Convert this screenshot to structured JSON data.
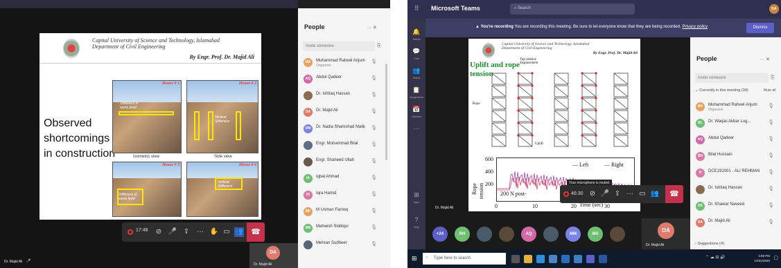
{
  "left": {
    "slide": {
      "university": "Capital University of Science and Technology, Islamabad",
      "department": "Department of Civil Engineering",
      "author": "By Engr. Prof. Dr. Majid Ali",
      "title_lines": [
        "Observed",
        "shortcomings",
        "in construction"
      ],
      "photos": [
        {
          "tag": "House # 1",
          "caption": "Stiffeners in same level"
        },
        {
          "tag": "House # 2",
          "caption": "Vertical Stiffeners"
        },
        {
          "tag": "House # 3",
          "caption": "Stiffeners at same level"
        },
        {
          "tag": "House # 4",
          "caption": "Vertical Stiffeners"
        }
      ],
      "view_captions": [
        "Isometric view",
        "Side view"
      ]
    },
    "presenter_name": "Dr. Majid Ali",
    "timer": "17:48",
    "self_tile": {
      "initials": "DA",
      "name": "Dr. Majid Ali"
    },
    "people": {
      "title": "People",
      "header_icons": "··· ✕",
      "invite_placeholder": "Invite someone",
      "items": [
        {
          "initials": "MA",
          "name": "Muhammad Raheel Anjum",
          "sub": "Organizer",
          "color": "#e8a15e"
        },
        {
          "initials": "AQ",
          "name": "Abdul Qadeer",
          "sub": "",
          "color": "#d36aa8"
        },
        {
          "initials": "",
          "name": "Dr. Ishtiaq Hassan",
          "sub": "",
          "color": "#8a6a50"
        },
        {
          "initials": "DA",
          "name": "Dr. Majid Ali",
          "sub": "",
          "color": "#e07a6b"
        },
        {
          "initials": "DM",
          "name": "Dr. Nadia Shamshad Malik",
          "sub": "",
          "color": "#7b83eb"
        },
        {
          "initials": "",
          "name": "Engr. Muhammad Bilal",
          "sub": "",
          "color": "#5a6f88"
        },
        {
          "initials": "",
          "name": "Engr. Shaheed Ullah",
          "sub": "",
          "color": "#6a5a4a"
        },
        {
          "initials": "IA",
          "name": "Iqbal Ahmad",
          "sub": "",
          "color": "#6fbf73"
        },
        {
          "initials": "IH",
          "name": "Iqra Hamid",
          "sub": "",
          "color": "#d97aa6"
        },
        {
          "initials": "MF",
          "name": "M Usman Farooq",
          "sub": "",
          "color": "#e4a35c"
        },
        {
          "initials": "MS",
          "name": "Mahwish Siddiqui",
          "sub": "",
          "color": "#6fbf73"
        },
        {
          "initials": "",
          "name": "Mehran Sudheer",
          "sub": "",
          "color": "#556677"
        }
      ]
    }
  },
  "right": {
    "app_title": "Microsoft Teams",
    "search_placeholder": "Search",
    "user_initials": "DA",
    "rail": [
      {
        "icon": "bell-icon",
        "glyph": "🔔",
        "label": "Activity"
      },
      {
        "icon": "chat-icon",
        "glyph": "💬",
        "label": "Chat"
      },
      {
        "icon": "teams-icon",
        "glyph": "👥",
        "label": "Teams"
      },
      {
        "icon": "assignments-icon",
        "glyph": "📋",
        "label": "Assignments"
      },
      {
        "icon": "calendar-icon",
        "glyph": "📅",
        "label": "Calendar"
      },
      {
        "icon": "more-icon",
        "glyph": "···",
        "label": ""
      },
      {
        "icon": "apps-icon",
        "glyph": "⊞",
        "label": "Apps"
      },
      {
        "icon": "help-icon",
        "glyph": "?",
        "label": "Help"
      }
    ],
    "banner": {
      "bold": "You're recording",
      "text": "You are recording this meeting. Be sure to let everyone know that they are being recorded.",
      "link": "Privacy policy",
      "dismiss": "Dismiss"
    },
    "slide": {
      "university": "Capital University of Science and Technology, Islamabad",
      "department": "Department of Civil Engineering",
      "author": "By Engr. Prof. Dr. Majid Ali",
      "title_lines": [
        "Uplift and rope",
        "tension"
      ],
      "annotations": {
        "top_disp": "Top relative displacement",
        "rope": "Rope",
        "uplift": "Uplift"
      },
      "legend_left": "Left",
      "legend_right": "Right",
      "x_label": "Time (sec)",
      "y_label_1": "Rope",
      "y_label_2": "tension",
      "y_ticks": [
        "600",
        "400",
        "200"
      ],
      "x_ticks": [
        "0",
        "10",
        "20",
        "30"
      ],
      "note": "200 N post-"
    },
    "toast": "Your microphone is muted.",
    "timer": "46:30",
    "presenter_name": "Dr. Majid Ali",
    "gallery": [
      {
        "initials": "+24",
        "color": "#5b5fc7"
      },
      {
        "initials": "RH",
        "color": "#6fbf73"
      },
      {
        "initials": "",
        "color": "#4a5a6a"
      },
      {
        "initials": "",
        "color": "#5a4a3a"
      },
      {
        "initials": "AQ",
        "color": "#d36aa8"
      },
      {
        "initials": "",
        "color": "#4a5a6a"
      },
      {
        "initials": "MM",
        "color": "#7b83eb"
      },
      {
        "initials": "MS",
        "color": "#6fbf73"
      },
      {
        "initials": "",
        "color": "#5a4a3a"
      }
    ],
    "self_tile": {
      "initials": "DA",
      "name": "Dr. Majid Ali"
    },
    "people": {
      "title": "People",
      "header_icons": "··· ✕",
      "invite_placeholder": "Invite someone",
      "section": "Currently in this meeting (34)",
      "mute_all": "Mute all",
      "items": [
        {
          "initials": "MA",
          "name": "Muhammad Raheel Anjum",
          "sub": "Organizer",
          "color": "#e8a15e"
        },
        {
          "initials": "DL",
          "name": "Dr. Waqas Akbar Lug...",
          "sub": "",
          "color": "#6fbf73"
        },
        {
          "initials": "AQ",
          "name": "Abdul Qadeer",
          "sub": "",
          "color": "#d36aa8"
        },
        {
          "initials": "BH",
          "name": "Bilal Hussain",
          "sub": "",
          "color": "#d97aa6"
        },
        {
          "initials": "D",
          "name": "DCE191001 - ALI REHMAN",
          "sub": "",
          "color": "#d97aa6"
        },
        {
          "initials": "",
          "name": "Dr. Ishtiaq Hassan",
          "sub": "",
          "color": "#8a6a50"
        },
        {
          "initials": "DK",
          "name": "Dr. Khawar Naveed",
          "sub": "",
          "color": "#6fbf73"
        },
        {
          "initials": "DA",
          "name": "Dr. Majid Ali",
          "sub": "",
          "color": "#e07a6b"
        }
      ],
      "suggestions": "Suggestions (4)"
    },
    "taskbar": {
      "search": "Type here to search",
      "time": "3:59 PM",
      "date": "12/31/2020"
    }
  }
}
